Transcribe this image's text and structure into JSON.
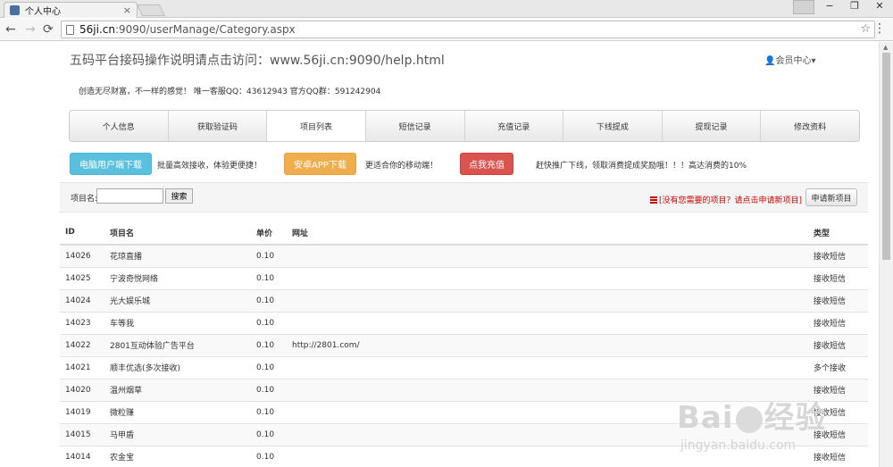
{
  "browser": {
    "tab_title": "个人中心",
    "tab_close": "×",
    "url_host": "56ji.cn",
    "url_rest": ":9090/userManage/Category.aspx",
    "back": "←",
    "forward": "→",
    "reload": "⟳",
    "star": "☆",
    "menu": "⋮",
    "min": "−",
    "restore": "❐",
    "close": "✕"
  },
  "header": {
    "title": "五码平台接码操作说明请点击访问：www.56ji.cn:9090/help.html",
    "member": "会员中心",
    "slogan": "创造无尽财富，不一样的感觉！ 唯一客服QQ：43612943 官方QQ群：591242904"
  },
  "nav": {
    "items": [
      "个人信息",
      "获取验证码",
      "项目列表",
      "短信记录",
      "充值记录",
      "下线提成",
      "提现记录",
      "修改资料"
    ],
    "active": "项目列表"
  },
  "promo": {
    "pc_btn": "电脑用户端下载",
    "pc_text": "批量高效接收，体验更便捷！",
    "app_btn": "安卓APP下载",
    "app_text": "更适合你的移动端！",
    "recharge_btn": "点我充值",
    "recharge_text": "赶快推广下线，领取消费提成奖励哦！！！高达消费的10%"
  },
  "search": {
    "label": "项目名:",
    "value": "",
    "button": "搜索",
    "apply_link": "[没有您需要的项目？请点击申请新项目]",
    "apply_button": "申请新项目"
  },
  "table": {
    "headers": [
      "ID",
      "项目名",
      "单价",
      "网址",
      "类型"
    ],
    "rows": [
      [
        "14026",
        "花琼直播",
        "0.10",
        "",
        "接收短信"
      ],
      [
        "14025",
        "宁波奇悦网络",
        "0.10",
        "",
        "接收短信"
      ],
      [
        "14024",
        "光大娱乐城",
        "0.10",
        "",
        "接收短信"
      ],
      [
        "14023",
        "车等我",
        "0.10",
        "",
        "接收短信"
      ],
      [
        "14022",
        "2801互动体验广告平台",
        "0.10",
        "http://2801.com/",
        "接收短信"
      ],
      [
        "14021",
        "顺丰优选(多次接收)",
        "0.10",
        "",
        "多个接收"
      ],
      [
        "14020",
        "温州烟草",
        "0.10",
        "",
        "接收短信"
      ],
      [
        "14019",
        "微粒赚",
        "0.10",
        "",
        "接收短信"
      ],
      [
        "14015",
        "马甲盾",
        "0.10",
        "",
        "接收短信"
      ],
      [
        "14014",
        "农金宝",
        "0.10",
        "",
        "接收短信"
      ]
    ]
  },
  "watermark": {
    "logo_left": "Bai",
    "logo_right": "经验",
    "url": "jingyan.baidu.com"
  }
}
